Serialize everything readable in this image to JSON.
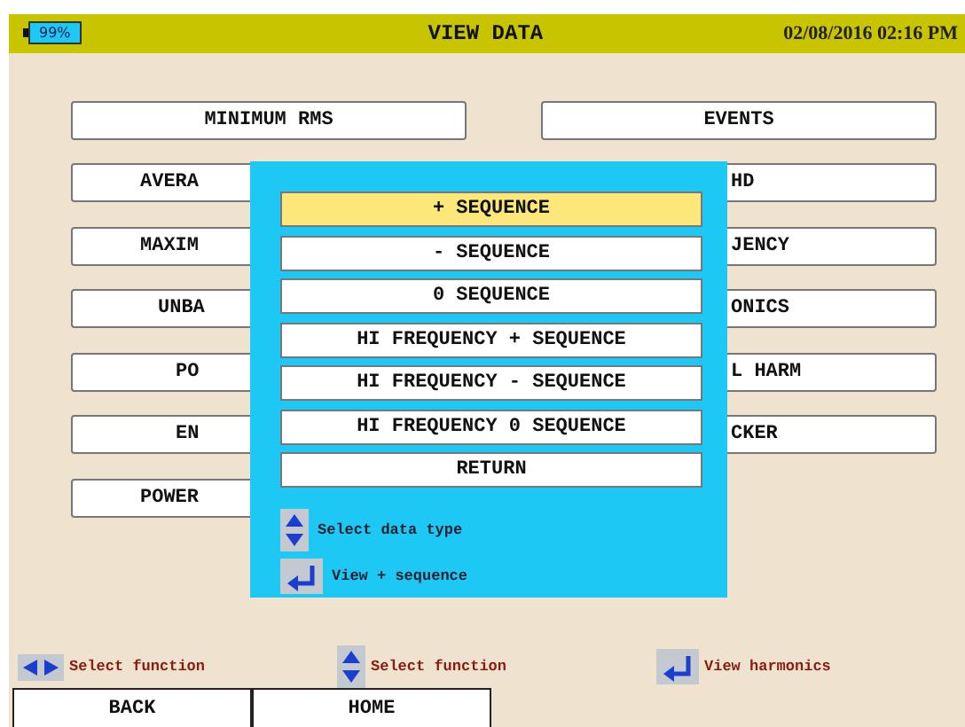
{
  "status_bar": {
    "battery": "99%",
    "title": "VIEW DATA",
    "datetime": "02/08/2016 02:16 PM"
  },
  "left_buttons": [
    {
      "label": "MINIMUM RMS",
      "kind": "full"
    },
    {
      "label": "AVERA",
      "kind": "cut"
    },
    {
      "label": "MAXIM",
      "kind": "cut"
    },
    {
      "label": "UNBA",
      "kind": "cut"
    },
    {
      "label": "PO",
      "kind": "cut"
    },
    {
      "label": "EN",
      "kind": "cut"
    },
    {
      "label": "POWER",
      "kind": "cut"
    }
  ],
  "right_buttons": [
    {
      "label": "EVENTS",
      "kind": "full"
    },
    {
      "label": "HD",
      "kind": "cut"
    },
    {
      "label": "JENCY",
      "kind": "cut"
    },
    {
      "label": "ONICS",
      "kind": "cut"
    },
    {
      "label": "L HARM",
      "kind": "cut"
    },
    {
      "label": "CKER",
      "kind": "cut"
    }
  ],
  "popup": {
    "items": [
      {
        "label": "+ SEQUENCE",
        "selected": true
      },
      {
        "label": "- SEQUENCE",
        "selected": false
      },
      {
        "label": "0 SEQUENCE",
        "selected": false
      },
      {
        "label": "HI FREQUENCY + SEQUENCE",
        "selected": false
      },
      {
        "label": "HI FREQUENCY - SEQUENCE",
        "selected": false
      },
      {
        "label": "HI FREQUENCY 0 SEQUENCE",
        "selected": false
      },
      {
        "label": "RETURN",
        "selected": false
      }
    ],
    "hints": [
      {
        "kind": "updown",
        "text": "Select data type"
      },
      {
        "kind": "enter",
        "text": "View + sequence"
      }
    ]
  },
  "hints": [
    {
      "kind": "leftright",
      "text": "Select function"
    },
    {
      "kind": "updown",
      "text": "Select function"
    },
    {
      "kind": "enter",
      "text": "View harmonics"
    }
  ],
  "tabs": [
    {
      "label": "BACK"
    },
    {
      "label": "HOME"
    }
  ]
}
